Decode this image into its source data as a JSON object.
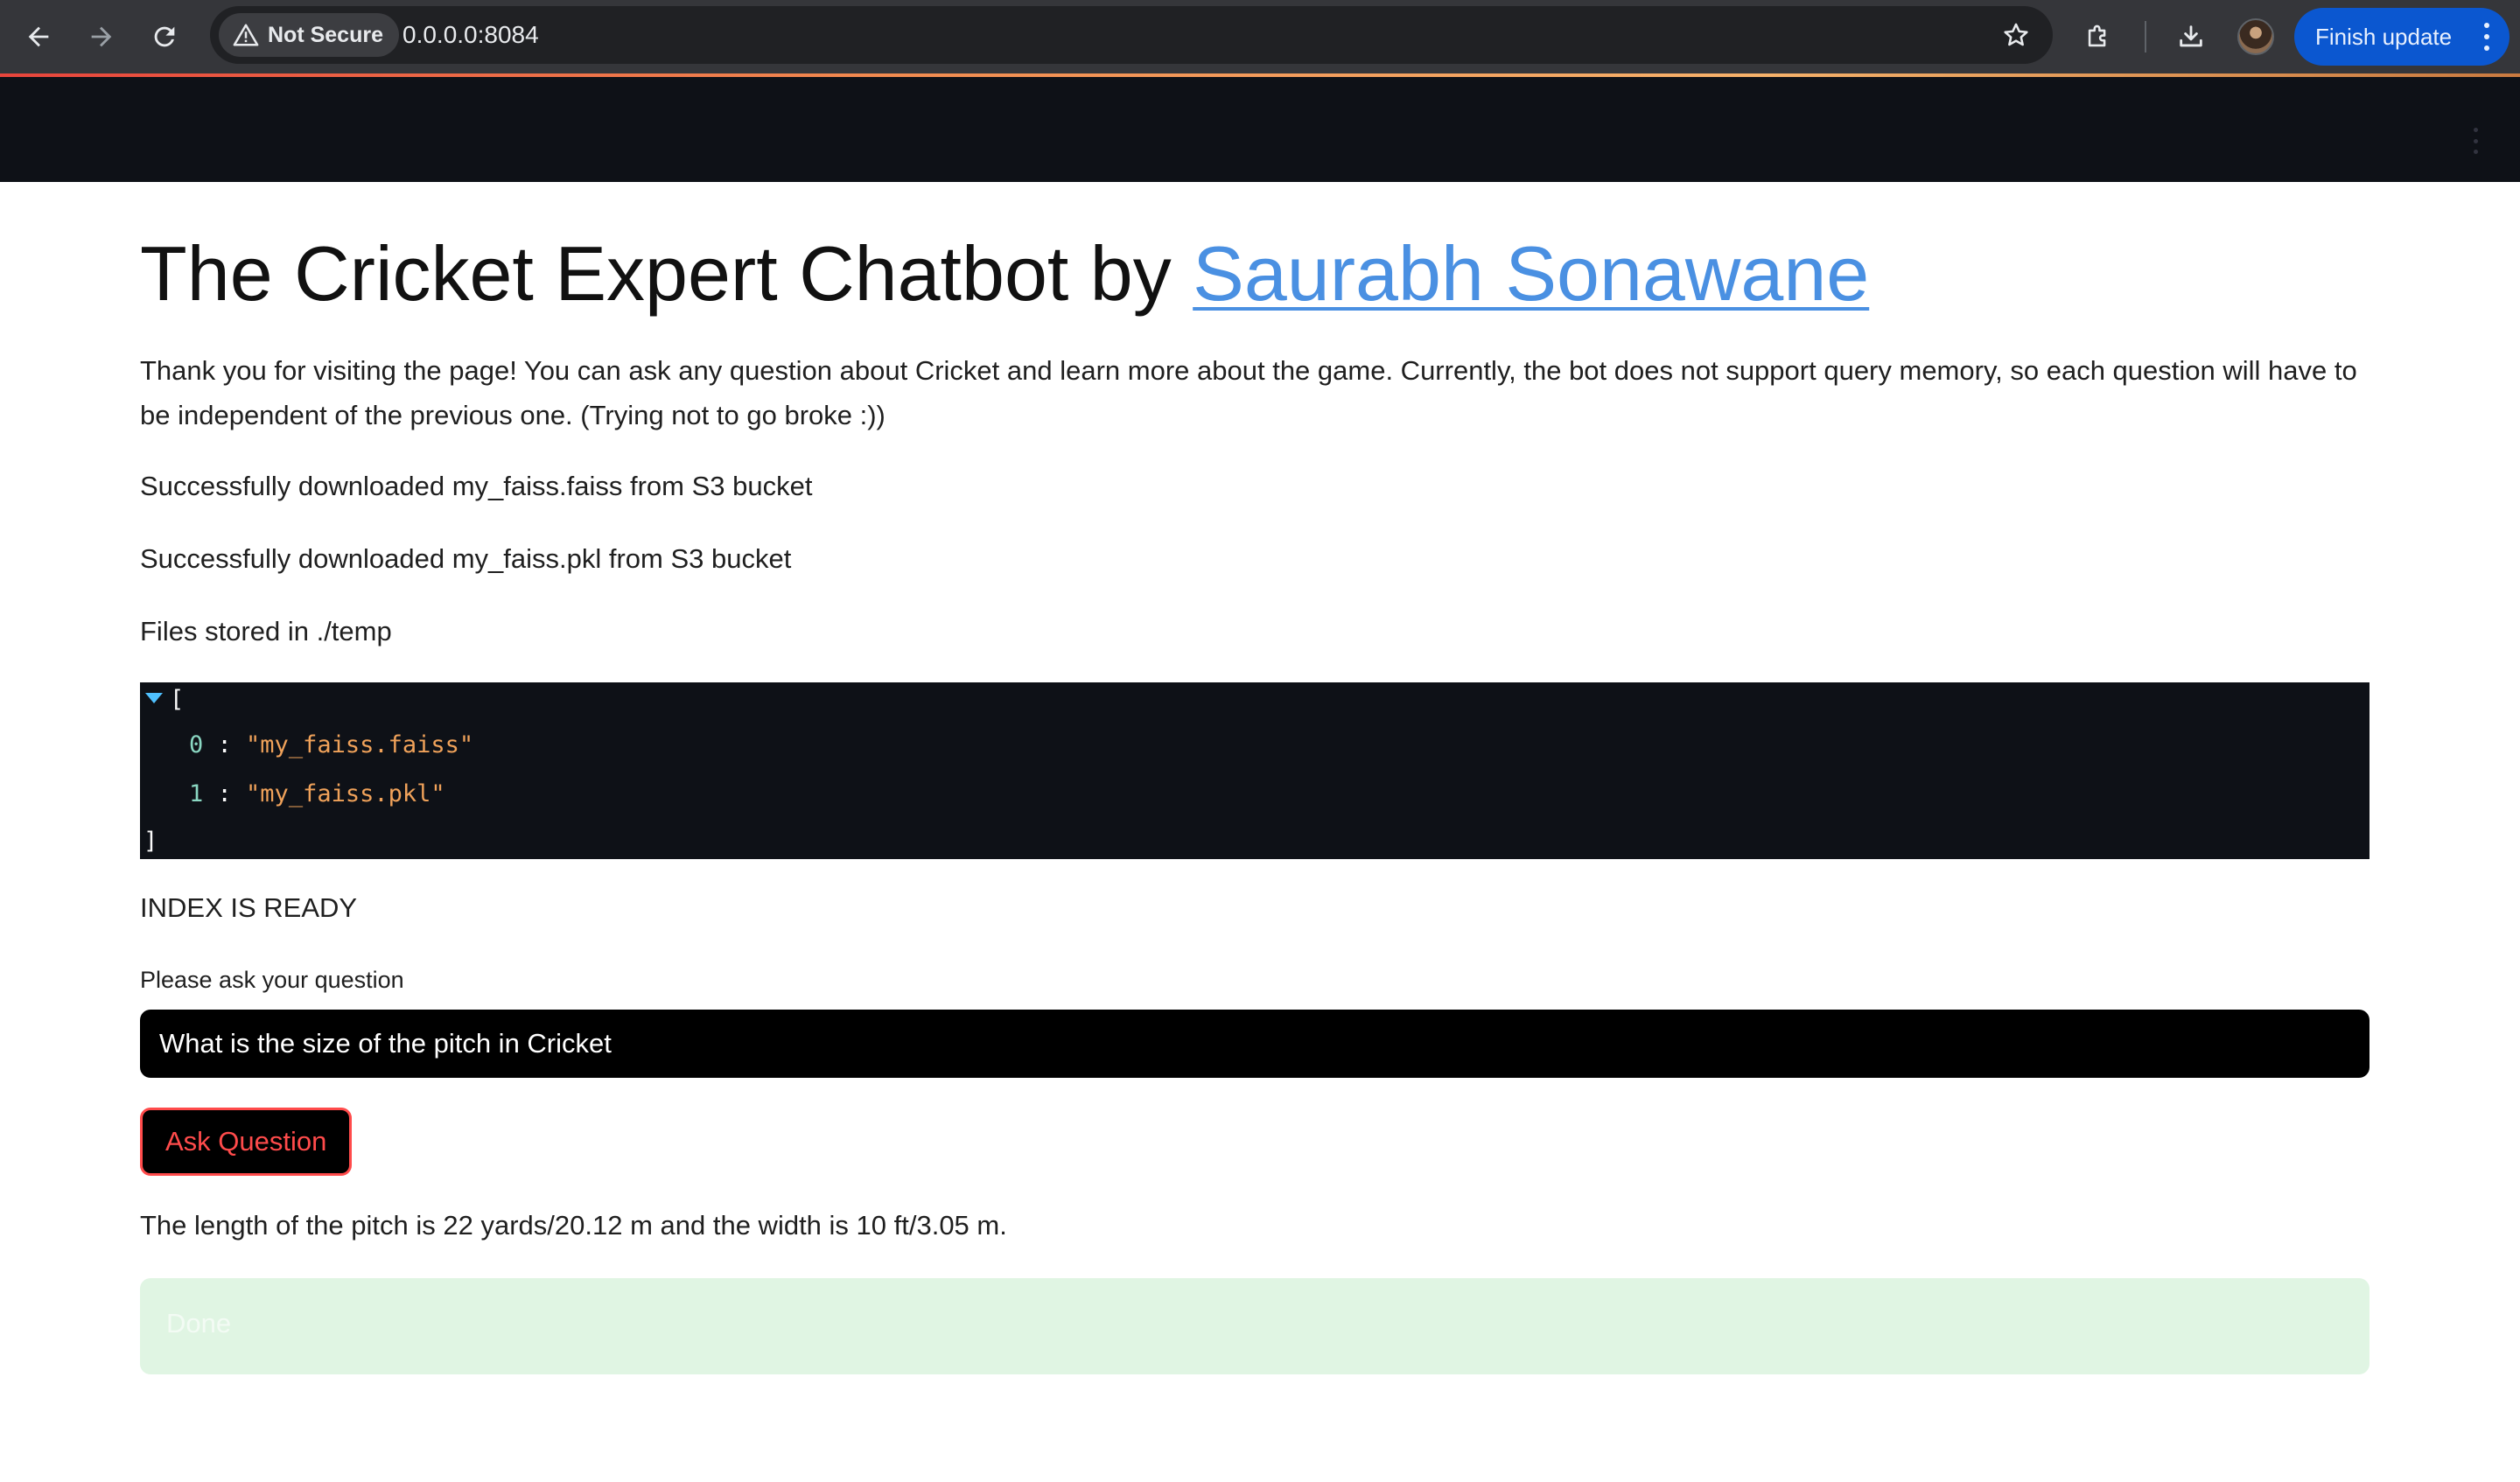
{
  "browser": {
    "security_label": "Not Secure",
    "url": "0.0.0.0:8084",
    "update_button": "Finish update"
  },
  "page": {
    "title_prefix": "The Cricket Expert Chatbot by ",
    "title_link": "Saurabh Sonawane",
    "intro": "Thank you for visiting the page! You can ask any question about Cricket and learn more about the game. Currently, the bot does not support query memory, so each question will have to be independent of the previous one. (Trying not to go broke :))",
    "download_msg_1": "Successfully downloaded my_faiss.faiss from S3 bucket",
    "download_msg_2": "Successfully downloaded my_faiss.pkl from S3 bucket",
    "files_stored": "Files stored in ./temp",
    "json_list": {
      "open_bracket": "[",
      "close_bracket": "]",
      "items": [
        {
          "index": "0",
          "sep": " : ",
          "value": "\"my_faiss.faiss\""
        },
        {
          "index": "1",
          "sep": " : ",
          "value": "\"my_faiss.pkl\""
        }
      ]
    },
    "index_status": "INDEX IS READY",
    "question_label": "Please ask your question",
    "question_value": "What is the size of the pitch in Cricket",
    "ask_button": "Ask Question",
    "answer": "The length of the pitch is 22 yards/20.12 m and the width is 10 ft/3.05 m.",
    "success_message": "Done"
  },
  "colors": {
    "link": "#4a90e2",
    "button_accent": "#ff4b4b",
    "header_bg": "#0e1117",
    "success_bg": "#e0f5e3",
    "update_button_bg": "#0b57d0"
  },
  "icons": {
    "back": "arrow-left-icon",
    "forward": "arrow-right-icon",
    "reload": "reload-icon",
    "warning": "warning-triangle-icon",
    "bookmark": "star-icon",
    "extensions": "puzzle-icon",
    "downloads": "download-icon",
    "menu": "kebab-menu-icon"
  }
}
